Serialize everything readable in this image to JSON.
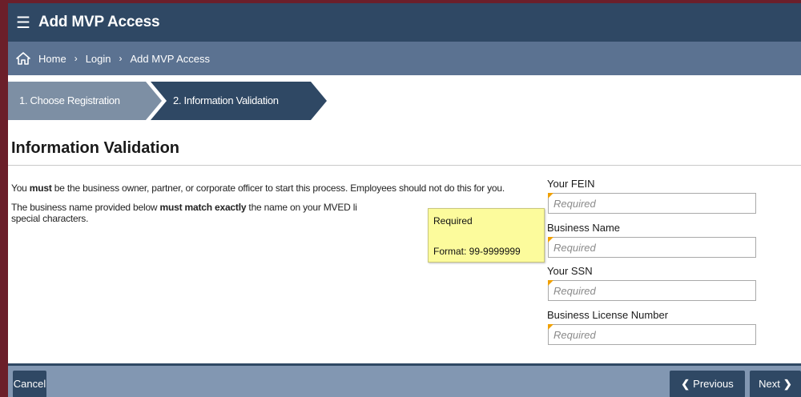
{
  "app": {
    "title": "Add MVP Access"
  },
  "breadcrumb": {
    "items": [
      {
        "label": "Home"
      },
      {
        "label": "Login"
      },
      {
        "label": "Add MVP Access"
      }
    ]
  },
  "steps": [
    {
      "label": "1. Choose Registration"
    },
    {
      "label": "2. Information Validation"
    }
  ],
  "page": {
    "heading": "Information Validation",
    "intro1_a": "You ",
    "intro1_b": "must",
    "intro1_c": " be the business owner, partner, or corporate officer to start this process. Employees should not do this for you.",
    "intro2_a": "The business name provided below ",
    "intro2_b": "must match exactly",
    "intro2_c": " the name on your MVED li",
    "intro2_d": "special characters."
  },
  "tooltip": {
    "line1": "Required",
    "line2": "Format: 99-9999999"
  },
  "form": {
    "fields": [
      {
        "label": "Your FEIN",
        "placeholder": "Required",
        "value": ""
      },
      {
        "label": "Business Name",
        "placeholder": "Required",
        "value": ""
      },
      {
        "label": "Your SSN",
        "placeholder": "Required",
        "value": ""
      },
      {
        "label": "Business License Number",
        "placeholder": "Required",
        "value": ""
      }
    ]
  },
  "footer": {
    "cancel_label": "Cancel",
    "previous_label": "Previous",
    "next_label": "Next"
  },
  "colors": {
    "header": "#2f4864",
    "breadcrumb": "#5b7291",
    "step_inactive": "#7d8fa4",
    "step_active": "#2f4864",
    "footer": "#8297b2",
    "tooltip": "#fcfb9c",
    "required_marker": "#f0a000"
  },
  "icons": {
    "menu": "hamburger-icon",
    "home": "home-icon",
    "prev": "chevron-left-icon",
    "next": "chevron-right-icon"
  }
}
